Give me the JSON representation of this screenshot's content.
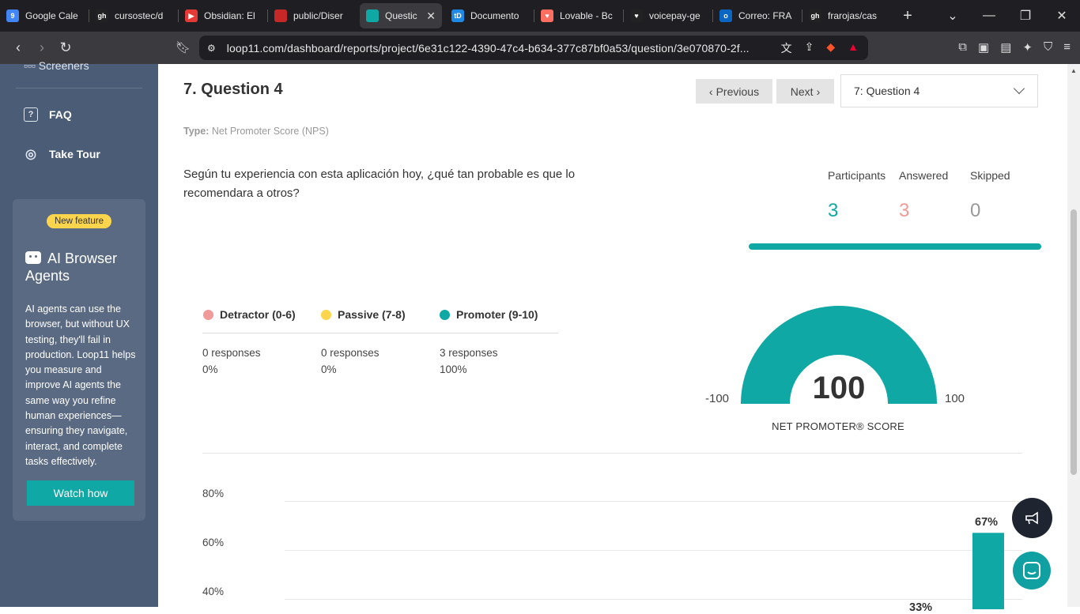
{
  "browser": {
    "tabs": [
      {
        "label": "Google Cale",
        "color": "#4285f4",
        "glyph": "9"
      },
      {
        "label": "cursostec/d",
        "color": "#222222",
        "glyph": "gh"
      },
      {
        "label": "Obsidian: El",
        "color": "#e53935",
        "glyph": "▶"
      },
      {
        "label": "public/Diser",
        "color": "#c62828",
        "glyph": "pdf"
      },
      {
        "label": "Questic",
        "color": "#10a8a4",
        "glyph": "loop"
      },
      {
        "label": "Documento",
        "color": "#1e88e5",
        "glyph": "tD"
      },
      {
        "label": "Lovable - Bc",
        "color": "#ff6f61",
        "glyph": "♥"
      },
      {
        "label": "voicepay-ge",
        "color": "#222222",
        "glyph": "♥"
      },
      {
        "label": "Correo: FRA",
        "color": "#0a66c2",
        "glyph": "o"
      },
      {
        "label": "frarojas/cas",
        "color": "#222222",
        "glyph": "gh"
      }
    ],
    "url": "loop11.com/dashboard/reports/project/6e31c122-4390-47c4-b634-377c87bf0a53/question/3e070870-2f...",
    "brave_shield_count": "6"
  },
  "sidebar": {
    "partial_item": "Screeners",
    "items": [
      {
        "label": "FAQ",
        "icon": "question-icon"
      },
      {
        "label": "Take Tour",
        "icon": "location-pin-icon"
      }
    ],
    "promo": {
      "badge": "New feature",
      "title": "AI Browser Agents",
      "body": "AI agents can use the browser, but without UX testing, they'll fail in production. Loop11 helps you measure and improve AI agents the same way you refine human experiences—ensuring they navigate, interact, and complete tasks effectively.",
      "button": "Watch how"
    }
  },
  "question": {
    "title": "7. Question 4",
    "prev_label": "Previous",
    "next_label": "Next",
    "selector_value": "7: Question 4",
    "type_label": "Type:",
    "type_value": "Net Promoter Score (NPS)",
    "text": "Según tu experiencia con esta aplicación hoy, ¿qué tan probable es que lo recomendara a otros?"
  },
  "stats": {
    "participants_label": "Participants",
    "participants_value": "3",
    "answered_label": "Answered",
    "answered_value": "3",
    "skipped_label": "Skipped",
    "skipped_value": "0",
    "answered_fraction": 1.0
  },
  "categories": [
    {
      "label": "Detractor (0-6)",
      "color": "#f19a9a",
      "responses": "0 responses",
      "percent": "0%"
    },
    {
      "label": "Passive (7-8)",
      "color": "#fbd54b",
      "responses": "0 responses",
      "percent": "0%"
    },
    {
      "label": "Promoter (9-10)",
      "color": "#10a8a4",
      "responses": "3 responses",
      "percent": "100%"
    }
  ],
  "nps": {
    "score": "100",
    "min": "-100",
    "max": "100",
    "label": "NET PROMOTER® SCORE",
    "fill_fraction": 1.0
  },
  "colors": {
    "teal": "#10a8a4",
    "coral": "#f19a9a",
    "grey": "#999999",
    "sidebar": "#4b5c76"
  },
  "chart_data": {
    "type": "bar",
    "yticks": [
      "80%",
      "60%",
      "40%"
    ],
    "ylim": [
      0,
      80
    ],
    "bars": [
      {
        "value": 67,
        "label": "67%"
      }
    ],
    "partial_label": "33%"
  }
}
